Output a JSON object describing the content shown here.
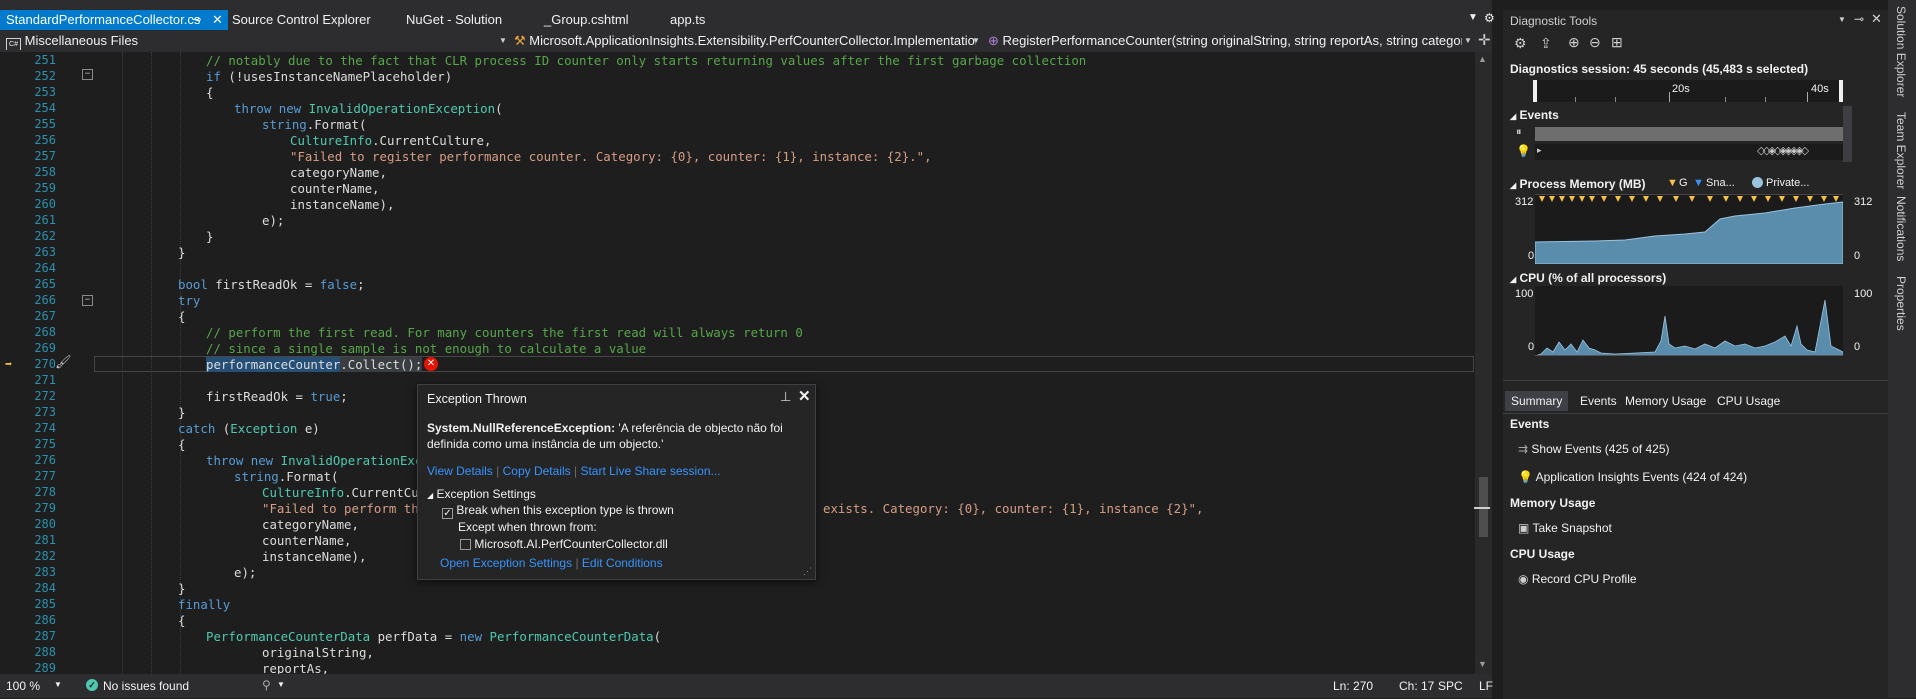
{
  "tabs": [
    {
      "label": "StandardPerformanceCollector.cs",
      "active": true
    },
    {
      "label": "Source Control Explorer"
    },
    {
      "label": "NuGet - Solution"
    },
    {
      "label": "_Group.cshtml"
    },
    {
      "label": "app.ts"
    }
  ],
  "nav": {
    "project": "Miscellaneous Files",
    "class": "Microsoft.ApplicationInsights.Extensibility.PerfCounterCollector.Implementation.Stan",
    "member": "RegisterPerformanceCounter(string originalString, string reportAs, string categoryNam"
  },
  "line_numbers": [
    "251",
    "252",
    "253",
    "254",
    "255",
    "256",
    "257",
    "258",
    "259",
    "260",
    "261",
    "262",
    "263",
    "264",
    "265",
    "266",
    "267",
    "268",
    "269",
    "270",
    "271",
    "272",
    "273",
    "274",
    "275",
    "276",
    "277",
    "278",
    "279",
    "280",
    "281",
    "282",
    "283",
    "284",
    "285",
    "286",
    "287",
    "288",
    "289"
  ],
  "code": {
    "l251": "// notably due to the fact that CLR process ID counter only starts returning values after the first garbage collection",
    "l252a": "if",
    "l252b": " (!usesInstanceNamePlaceholder)",
    "l253": "{",
    "l254a": "throw new ",
    "l254b": "InvalidOperationException",
    "l254c": "(",
    "l255a": "string",
    "l255b": ".Format(",
    "l256a": "CultureInfo",
    "l256b": ".CurrentCulture,",
    "l257": "\"Failed to register performance counter. Category: {0}, counter: {1}, instance: {2}.\",",
    "l258": "categoryName,",
    "l259": "counterName,",
    "l260": "instanceName),",
    "l261": "e);",
    "l262": "}",
    "l263": "}",
    "l264": "",
    "l265a": "bool",
    "l265b": " firstReadOk = ",
    "l265c": "false",
    "l265d": ";",
    "l266": "try",
    "l267": "{",
    "l268": "// perform the first read. For many counters the first read will always return 0",
    "l269": "// since a single sample is not enough to calculate a value",
    "l270a": "performanceCounter",
    "l270b": ".Collect();",
    "l271": "",
    "l272a": "firstReadOk = ",
    "l272b": "true",
    "l272c": ";",
    "l273": "}",
    "l274a": "catch",
    "l274b": " (",
    "l274c": "Exception",
    "l274d": " e)",
    "l275": "{",
    "l276a": "throw new ",
    "l276b": "InvalidOperationExce",
    "l277a": "string",
    "l277b": ".Format(",
    "l278a": "CultureInfo",
    "l278b": ".CurrentCult",
    "l279a": "\"Failed to perform the",
    "l279b": "exists. Category: {0}, counter: {1}, instance {2}\",",
    "l280": "categoryName,",
    "l281": "counterName,",
    "l282": "instanceName),",
    "l283": "e);",
    "l284": "}",
    "l285": "finally",
    "l286": "{",
    "l287a": "PerformanceCounterData",
    "l287b": " perfData = ",
    "l287c": "new",
    "l287d": " ",
    "l287e": "PerformanceCounterData",
    "l287f": "(",
    "l288": "originalString,",
    "l289": "reportAs,"
  },
  "popup": {
    "title": "Exception Thrown",
    "exception_type": "System.NullReferenceException:",
    "message_part1": " 'A referência de objecto não foi",
    "message_part2": "definida como uma instância de um objecto.'",
    "link_view": "View Details",
    "link_copy": "Copy Details",
    "link_share": "Start Live Share session...",
    "settings_header": "Exception Settings",
    "break_label": "Break when this exception type is thrown",
    "except_label": "Except when thrown from:",
    "module_label": "Microsoft.AI.PerfCounterCollector.dll",
    "link_open": "Open Exception Settings",
    "link_edit": "Edit Conditions"
  },
  "status": {
    "zoom": "100 %",
    "issues": "No issues found",
    "ln": "Ln: 270",
    "ch": "Ch: 17",
    "spc": "SPC",
    "lf": "LF"
  },
  "diag": {
    "title": "Diagnostic Tools",
    "session": "Diagnostics session: 45 seconds (45,483 s selected)",
    "tick_20": "20s",
    "tick_40": "40s",
    "events_header": "Events",
    "memory_header": "Process Memory (MB)",
    "memory_legend_gc": "G",
    "memory_legend_snap": "Sna...",
    "memory_legend_private": "Private...",
    "memory_max": "312",
    "memory_min": "0",
    "cpu_header": "CPU (% of all processors)",
    "cpu_max": "100",
    "cpu_min": "0",
    "tabs": [
      "Summary",
      "Events",
      "Memory Usage",
      "CPU Usage"
    ],
    "events_section": "Events",
    "show_events": "Show Events (425 of 425)",
    "ai_events": "Application Insights Events (424 of 424)",
    "memory_section": "Memory Usage",
    "take_snapshot": "Take Snapshot",
    "cpu_section": "CPU Usage",
    "record_cpu": "Record CPU Profile",
    "colors": {
      "accent": "#007acc",
      "memory_fill": "#5a8cab",
      "gc_marker": "#f5c044",
      "snapshot": "#3794ff",
      "error": "#e51400"
    }
  },
  "side_tabs": [
    "Solution Explorer",
    "Team Explorer",
    "Notifications",
    "Properties"
  ]
}
